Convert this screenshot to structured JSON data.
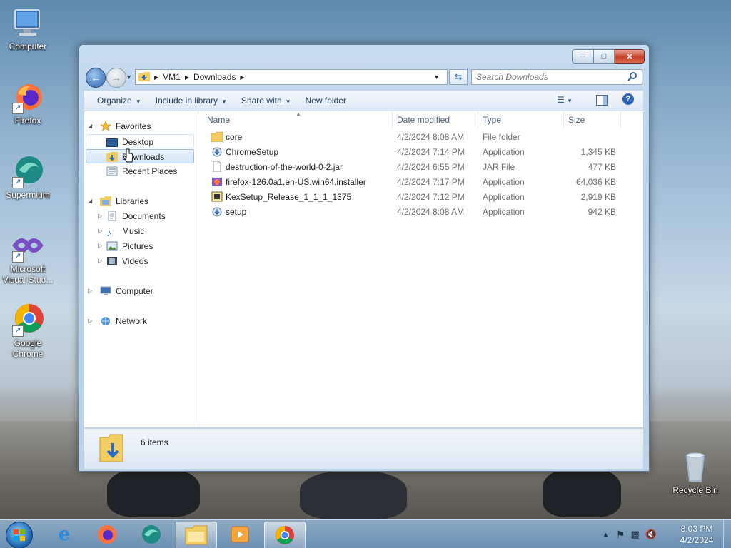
{
  "desktop": {
    "icons": [
      {
        "label": "Computer"
      },
      {
        "label": "Firefox"
      },
      {
        "label": "Supermium"
      },
      {
        "label": "Microsoft Visual Stud..."
      },
      {
        "label": "Google Chrome"
      },
      {
        "label": "Recycle Bin"
      }
    ]
  },
  "window": {
    "address": {
      "segments": [
        "VM1",
        "Downloads"
      ]
    },
    "search": {
      "placeholder": "Search Downloads"
    },
    "toolbar": {
      "organize": "Organize",
      "include_in_library": "Include in library",
      "share_with": "Share with",
      "new_folder": "New folder"
    },
    "nav": {
      "favorites": {
        "label": "Favorites",
        "items": [
          "Desktop",
          "Downloads",
          "Recent Places"
        ]
      },
      "libraries": {
        "label": "Libraries",
        "items": [
          "Documents",
          "Music",
          "Pictures",
          "Videos"
        ]
      },
      "computer": "Computer",
      "network": "Network"
    },
    "columns": {
      "name": "Name",
      "date": "Date modified",
      "type": "Type",
      "size": "Size"
    },
    "files": [
      {
        "name": "core",
        "date": "4/2/2024 8:08 AM",
        "type": "File folder",
        "size": "",
        "icon": "folder-icon"
      },
      {
        "name": "ChromeSetup",
        "date": "4/2/2024 7:14 PM",
        "type": "Application",
        "size": "1,345 KB",
        "icon": "installer-icon"
      },
      {
        "name": "destruction-of-the-world-0-2.jar",
        "date": "4/2/2024 6:55 PM",
        "type": "JAR File",
        "size": "477 KB",
        "icon": "file-icon"
      },
      {
        "name": "firefox-126.0a1.en-US.win64.installer",
        "date": "4/2/2024 7:17 PM",
        "type": "Application",
        "size": "64,036 KB",
        "icon": "firefox-installer-icon"
      },
      {
        "name": "KexSetup_Release_1_1_1_1375",
        "date": "4/2/2024 7:12 PM",
        "type": "Application",
        "size": "2,919 KB",
        "icon": "setup-icon"
      },
      {
        "name": "setup",
        "date": "4/2/2024 8:08 AM",
        "type": "Application",
        "size": "942 KB",
        "icon": "installer-icon"
      }
    ],
    "status": {
      "items_count": "6 items"
    }
  },
  "taskbar": {
    "clock": {
      "time": "8:03 PM",
      "date": "4/2/2024"
    }
  }
}
